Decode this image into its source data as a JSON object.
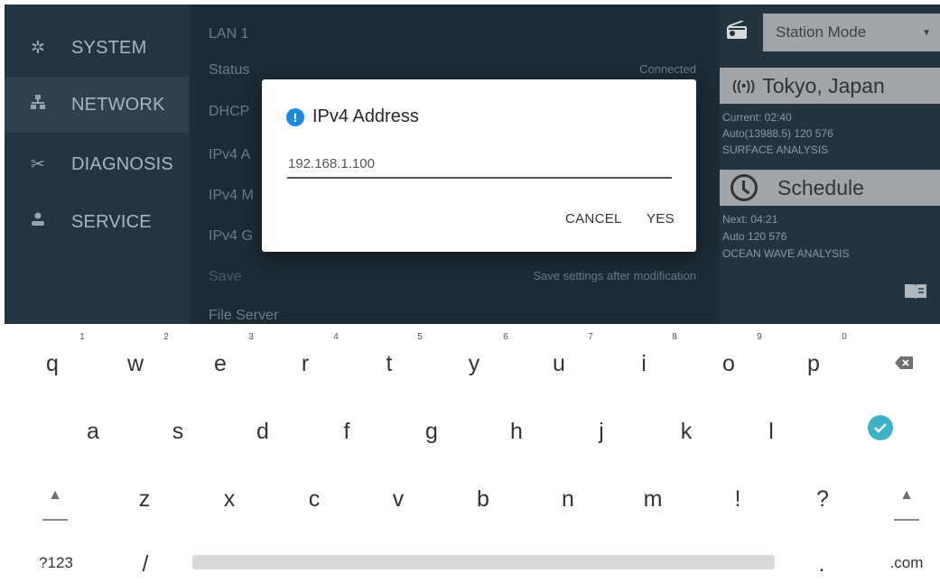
{
  "nav": {
    "items": [
      {
        "label": "SYSTEM",
        "icon": "gear-icon"
      },
      {
        "label": "NETWORK",
        "icon": "network-icon"
      },
      {
        "label": "DIAGNOSIS",
        "icon": "tools-icon"
      },
      {
        "label": "SERVICE",
        "icon": "person-icon"
      }
    ],
    "active": "NETWORK"
  },
  "content": {
    "section": "LAN 1",
    "rows": [
      {
        "label": "Status",
        "value": "Connected"
      },
      {
        "label": "DHCP"
      },
      {
        "label": "IPv4 A"
      },
      {
        "label": "IPv4 M"
      },
      {
        "label": "IPv4 G"
      }
    ],
    "save": {
      "label": "Save",
      "hint": "Save settings after modification"
    },
    "file_server": "File Server"
  },
  "side": {
    "mode": "Station Mode",
    "location": "Tokyo, Japan",
    "current": "Current:  02:40",
    "current_detail": "Auto(13988.5) 120  576",
    "current_product": "SURFACE ANALYSIS",
    "schedule": "Schedule",
    "next": "Next:  04:21",
    "next_detail": "Auto 120  576",
    "next_product": "OCEAN WAVE ANALYSIS"
  },
  "dialog": {
    "title": "IPv4 Address",
    "value": "192.168.1.100",
    "cancel": "CANCEL",
    "confirm": "YES"
  },
  "keyboard": {
    "row1": [
      "q",
      "w",
      "e",
      "r",
      "t",
      "y",
      "u",
      "i",
      "o",
      "p"
    ],
    "row1_numbers": [
      "1",
      "2",
      "3",
      "4",
      "5",
      "6",
      "7",
      "8",
      "9",
      "0"
    ],
    "row2": [
      "a",
      "s",
      "d",
      "f",
      "g",
      "h",
      "j",
      "k",
      "l"
    ],
    "row3": [
      "z",
      "x",
      "c",
      "v",
      "b",
      "n",
      "m",
      "!",
      "?"
    ],
    "symbols_key": "?123",
    "slash_key": "/",
    "period_key": ".",
    "com_key": ".com"
  },
  "colors": {
    "app_bg": "#1e2e3a",
    "accent": "#1e88e5",
    "enter_key": "#3db2c4"
  }
}
